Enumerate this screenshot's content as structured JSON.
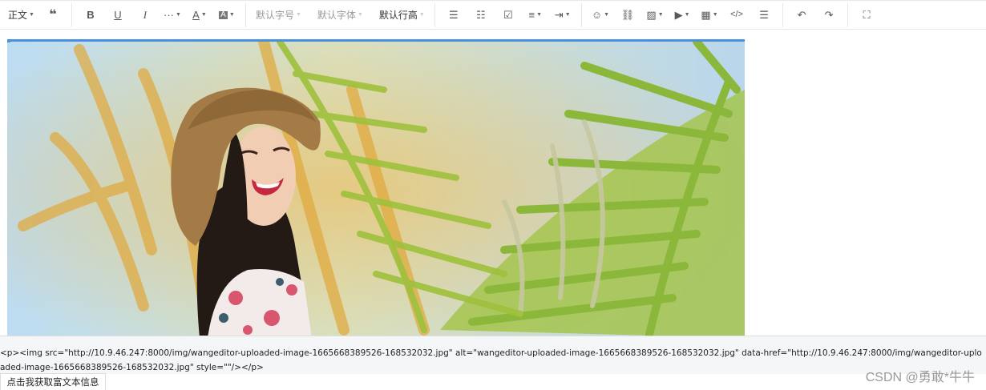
{
  "toolbar": {
    "header_select": "正文",
    "font_size": "默认字号",
    "font_family": "默认字体",
    "line_height": "默认行高"
  },
  "icons": {
    "blockquote": "quote-icon",
    "bold": "bold-icon",
    "underline": "underline-icon",
    "italic": "italic-icon",
    "more": "more-icon",
    "color": "font-color-icon",
    "bgcolor": "background-color-icon",
    "bulleted": "bulleted-list-icon",
    "numbered": "numbered-list-icon",
    "todo": "todo-icon",
    "justify": "align-icon",
    "indent": "indent-icon",
    "emotion": "emoji-icon",
    "link": "link-icon",
    "image": "image-icon",
    "video": "video-icon",
    "table": "table-icon",
    "code": "code-icon",
    "divider": "divider-icon",
    "undo": "undo-icon",
    "redo": "redo-icon",
    "fullscreen": "fullscreen-icon"
  },
  "editor": {
    "image_description": "photo in editor: woman wearing a straw hat beside palm fronds"
  },
  "source": {
    "html": "<p><img src=\"http://10.9.46.247:8000/img/wangeditor-uploaded-image-1665668389526-168532032.jpg\" alt=\"wangeditor-uploaded-image-1665668389526-168532032.jpg\" data-href=\"http://10.9.46.247:8000/img/wangeditor-uploaded-image-1665668389526-168532032.jpg\" style=\"\"/></p>"
  },
  "footer": {
    "button_label": "点击我获取富文本信息",
    "watermark": "CSDN @勇敢*牛牛"
  },
  "colors": {
    "selection": "#4a90e2",
    "toolbar_border": "#e8e8e8",
    "source_bg": "#f5f6f7"
  }
}
